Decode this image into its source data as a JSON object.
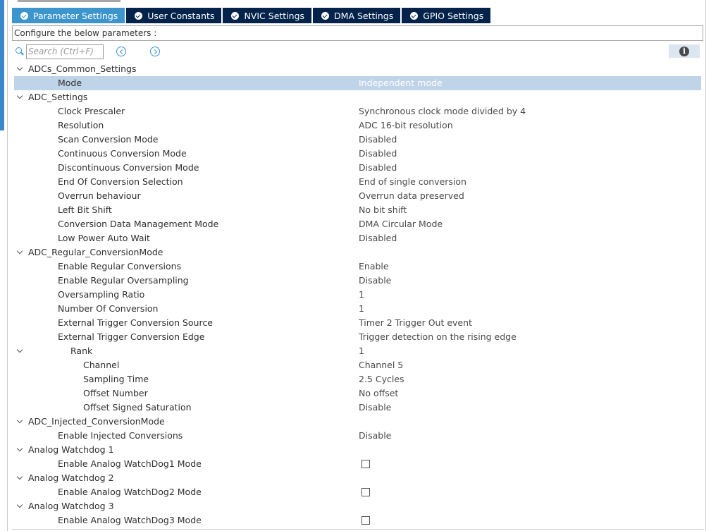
{
  "tabs": [
    {
      "label": "Parameter Settings",
      "active": true
    },
    {
      "label": "User Constants",
      "active": false
    },
    {
      "label": "NVIC Settings",
      "active": false
    },
    {
      "label": "DMA Settings",
      "active": false
    },
    {
      "label": "GPIO Settings",
      "active": false
    }
  ],
  "config_label": "Configure the below parameters :",
  "search": {
    "placeholder": "Search (Ctrl+F)",
    "value": ""
  },
  "icons": {
    "tab_status": "check-circle-icon",
    "search": "search-icon",
    "prev": "chevron-left-circle-icon",
    "next": "chevron-right-circle-icon",
    "info": "info-icon",
    "expand": "chevron-down-icon"
  },
  "colors": {
    "tab_active": "#3c95cd",
    "tab_inactive": "#03234b",
    "selected_row": "#bfd3e9"
  },
  "tree": {
    "adcs_common": {
      "title": "ADCs_Common_Settings",
      "mode": {
        "label": "Mode",
        "value": "Independent mode"
      }
    },
    "adc_settings": {
      "title": "ADC_Settings",
      "items": [
        {
          "label": "Clock Prescaler",
          "value": "Synchronous clock mode divided by 4"
        },
        {
          "label": "Resolution",
          "value": "ADC 16-bit resolution"
        },
        {
          "label": "Scan Conversion Mode",
          "value": "Disabled"
        },
        {
          "label": "Continuous Conversion Mode",
          "value": "Disabled"
        },
        {
          "label": "Discontinuous Conversion Mode",
          "value": "Disabled"
        },
        {
          "label": "End Of Conversion Selection",
          "value": "End of single conversion"
        },
        {
          "label": "Overrun behaviour",
          "value": "Overrun data preserved"
        },
        {
          "label": "Left Bit Shift",
          "value": "No bit shift"
        },
        {
          "label": "Conversion Data Management Mode",
          "value": "DMA Circular Mode"
        },
        {
          "label": "Low Power Auto Wait",
          "value": "Disabled"
        }
      ]
    },
    "adc_regular": {
      "title": "ADC_Regular_ConversionMode",
      "items": [
        {
          "label": "Enable Regular Conversions",
          "value": "Enable"
        },
        {
          "label": "Enable Regular Oversampling",
          "value": "Disable"
        },
        {
          "label": "Oversampling Ratio",
          "value": "1"
        },
        {
          "label": "Number Of Conversion",
          "value": "1"
        },
        {
          "label": "External Trigger Conversion Source",
          "value": "Timer 2 Trigger Out event"
        },
        {
          "label": "External Trigger Conversion Edge",
          "value": "Trigger detection on the rising edge"
        }
      ],
      "rank": {
        "label": "Rank",
        "value": "1",
        "items": [
          {
            "label": "Channel",
            "value": "Channel 5"
          },
          {
            "label": "Sampling Time",
            "value": "2.5 Cycles"
          },
          {
            "label": "Offset Number",
            "value": "No offset"
          },
          {
            "label": "Offset Signed Saturation",
            "value": "Disable"
          }
        ]
      }
    },
    "adc_injected": {
      "title": "ADC_Injected_ConversionMode",
      "items": [
        {
          "label": "Enable Injected Conversions",
          "value": "Disable"
        }
      ]
    },
    "watchdogs": [
      {
        "title": "Analog Watchdog 1",
        "label": "Enable Analog WatchDog1 Mode",
        "checked": false
      },
      {
        "title": "Analog Watchdog 2",
        "label": "Enable Analog WatchDog2 Mode",
        "checked": false
      },
      {
        "title": "Analog Watchdog 3",
        "label": "Enable Analog WatchDog3 Mode",
        "checked": false
      }
    ]
  }
}
